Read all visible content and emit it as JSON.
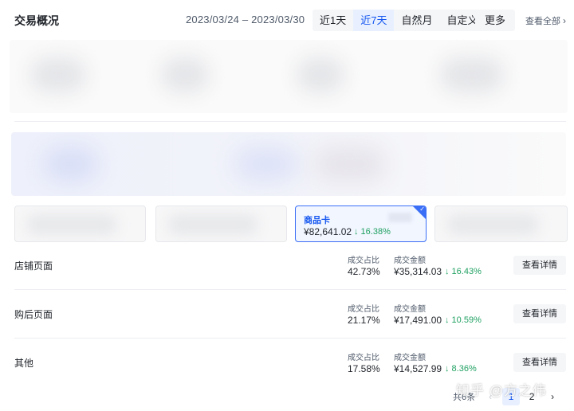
{
  "header": {
    "title": "交易概况",
    "date_range": "2023/03/24 – 2023/03/30",
    "range_tabs": [
      {
        "label": "近1天",
        "active": false
      },
      {
        "label": "近7天",
        "active": true
      },
      {
        "label": "自然月",
        "active": false
      },
      {
        "label": "自定义",
        "active": false
      }
    ],
    "more_label": "更多",
    "view_all_label": "查看全部"
  },
  "active_card": {
    "label": "商品卡",
    "value": "¥82,641.02",
    "change": "↓ 16.38%"
  },
  "rows": [
    {
      "name": "店铺页面",
      "share_label": "成交占比",
      "share": "42.73%",
      "amount_label": "成交金额",
      "amount": "¥35,314.03",
      "change": "↓ 16.43%",
      "button": "查看详情"
    },
    {
      "name": "购后页面",
      "share_label": "成交占比",
      "share": "21.17%",
      "amount_label": "成交金额",
      "amount": "¥17,491.00",
      "change": "↓ 10.59%",
      "button": "查看详情"
    },
    {
      "name": "其他",
      "share_label": "成交占比",
      "share": "17.58%",
      "amount_label": "成交金额",
      "amount": "¥14,527.99",
      "change": "↓ 8.36%",
      "button": "查看详情"
    }
  ],
  "pagination": {
    "total": "共6条",
    "prev": "‹",
    "pages": [
      "1",
      "2"
    ],
    "current": "1",
    "next": "›"
  },
  "watermark": "知乎 @方之伟",
  "colors": {
    "accent": "#1456f0",
    "positive_down": "#20a162",
    "tab_bg": "#f5f6f8"
  }
}
